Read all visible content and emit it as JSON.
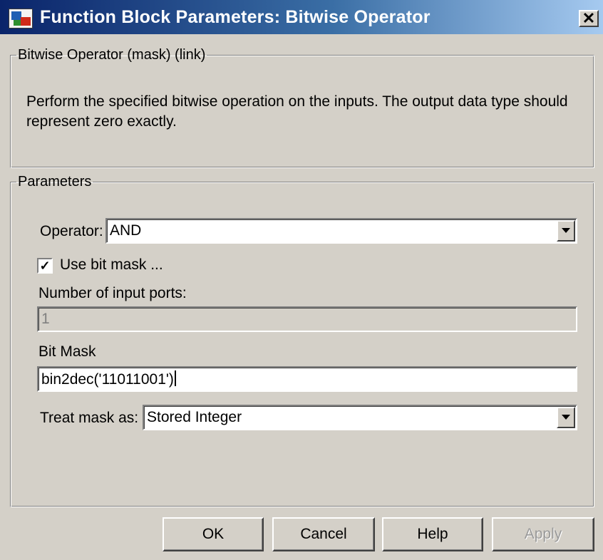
{
  "window": {
    "title": "Function Block Parameters: Bitwise Operator",
    "close_label": "✕",
    "icon": "simulink-block-icon"
  },
  "description_group": {
    "title": "Bitwise Operator (mask) (link)",
    "text": "Perform the specified bitwise operation on the inputs. The output data type should represent zero exactly."
  },
  "parameters_group": {
    "title": "Parameters",
    "operator": {
      "label": "Operator:",
      "value": "AND"
    },
    "use_bit_mask": {
      "label": "Use bit mask ...",
      "checked": true,
      "check_glyph": "✓"
    },
    "num_inputs": {
      "label": "Number of input ports:",
      "value": "1",
      "disabled": true
    },
    "bit_mask": {
      "label": "Bit Mask",
      "value": "bin2dec('11011001')"
    },
    "treat_mask_as": {
      "label": "Treat mask as:",
      "value": "Stored Integer"
    }
  },
  "buttons": {
    "ok": "OK",
    "cancel": "Cancel",
    "help": "Help",
    "apply": "Apply"
  }
}
